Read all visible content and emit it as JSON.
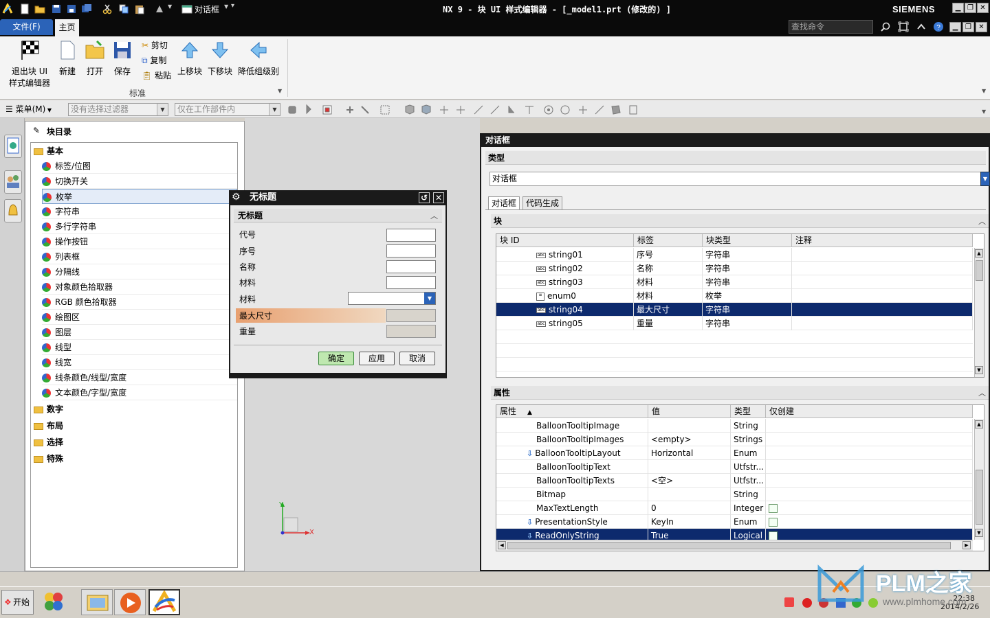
{
  "titlebar": {
    "quick_access_label": "对话框",
    "title": "NX 9 - 块 UI 样式编辑器 - [_model1.prt (修改的) ]",
    "brand": "SIEMENS",
    "minimize": "▁",
    "restore": "❐",
    "close": "✕"
  },
  "menubar": {
    "file_tab": "文件(F)",
    "home_tab": "主页",
    "search_placeholder": "查找命令"
  },
  "ribbon": {
    "exit_label_1": "退出块 UI",
    "exit_label_2": "样式编辑器",
    "new_label": "新建",
    "open_label": "打开",
    "save_label": "保存",
    "cut_label": "剪切",
    "copy_label": "复制",
    "paste_label": "粘贴",
    "move_up_label": "上移块",
    "move_down_label": "下移块",
    "demote_label": "降低组级别",
    "group_label": "标准"
  },
  "selection_bar": {
    "menu_label": "菜单(M)",
    "filter_value": "没有选择过滤器",
    "scope_value": "仅在工作部件内"
  },
  "catalog": {
    "title": "块目录",
    "folders": [
      "基本",
      "数字",
      "布局",
      "选择",
      "特殊"
    ],
    "items": [
      "标签/位图",
      "切换开关",
      "枚举",
      "字符串",
      "多行字符串",
      "操作按钮",
      "列表框",
      "分隔线",
      "对象颜色拾取器",
      "RGB 颜色拾取器",
      "绘图区",
      "图层",
      "线型",
      "线宽",
      "线条颜色/线型/宽度",
      "文本颜色/字型/宽度"
    ]
  },
  "preview_dialog": {
    "title": "无标题",
    "section": "无标题",
    "rows": [
      "代号",
      "序号",
      "名称",
      "材料",
      "材料",
      "最大尺寸",
      "重量"
    ],
    "ok": "确定",
    "apply": "应用",
    "cancel": "取消"
  },
  "right_panel": {
    "title": "对话框",
    "type_section": "类型",
    "type_value": "对话框",
    "tabs": [
      "对话框",
      "代码生成"
    ],
    "block_section": "块",
    "block_columns": [
      "块 ID",
      "标签",
      "块类型",
      "注释"
    ],
    "block_rows": [
      {
        "id": "string01",
        "label": "序号",
        "type": "字符串",
        "note": ""
      },
      {
        "id": "string02",
        "label": "名称",
        "type": "字符串",
        "note": ""
      },
      {
        "id": "string03",
        "label": "材料",
        "type": "字符串",
        "note": ""
      },
      {
        "id": "enum0",
        "label": "材料",
        "type": "枚举",
        "note": ""
      },
      {
        "id": "string04",
        "label": "最大尺寸",
        "type": "字符串",
        "note": ""
      },
      {
        "id": "string05",
        "label": "重量",
        "type": "字符串",
        "note": ""
      }
    ],
    "property_section": "属性",
    "property_columns": [
      "属性",
      "值",
      "类型",
      "仅创建"
    ],
    "property_rows": [
      {
        "name": "BalloonTooltipImage",
        "value": "",
        "type": "String",
        "create_only": false
      },
      {
        "name": "BalloonTooltipImages",
        "value": "<empty>",
        "type": "Strings",
        "create_only": false
      },
      {
        "name": "BalloonTooltipLayout",
        "value": "Horizontal",
        "type": "Enum",
        "create_only": false
      },
      {
        "name": "BalloonTooltipText",
        "value": "",
        "type": "Utfstr...",
        "create_only": false
      },
      {
        "name": "BalloonTooltipTexts",
        "value": "<空>",
        "type": "Utfstr...",
        "create_only": false
      },
      {
        "name": "Bitmap",
        "value": "",
        "type": "String",
        "create_only": false
      },
      {
        "name": "MaxTextLength",
        "value": "0",
        "type": "Integer",
        "create_only": true
      },
      {
        "name": "PresentationStyle",
        "value": "KeyIn",
        "type": "Enum",
        "create_only": true
      },
      {
        "name": "ReadOnlyString",
        "value": "True",
        "type": "Logical",
        "create_only": true
      }
    ]
  },
  "axes": {
    "x": "X",
    "y": "Y"
  },
  "taskbar": {
    "start_label": "开始",
    "clock_time": "22:38",
    "clock_date": "2014/2/26"
  },
  "watermark": {
    "text": "PLM之家",
    "url": "www.plmhome.com"
  },
  "colors": {
    "selected_row": "#0d2a6d",
    "titlebar": "#0a0a0a",
    "file_tab": "#2b63b8"
  }
}
